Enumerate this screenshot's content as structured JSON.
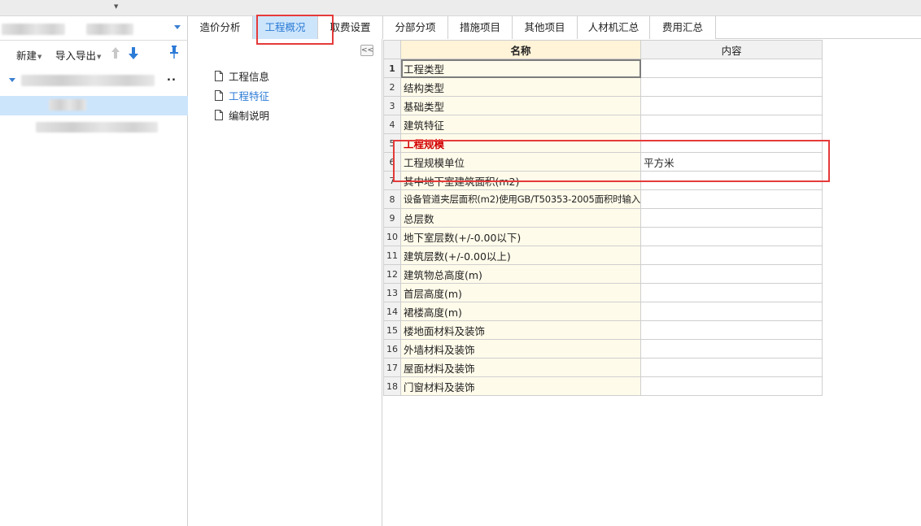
{
  "tabs": [
    {
      "label": "造价分析"
    },
    {
      "label": "工程概况"
    },
    {
      "label": "取费设置"
    },
    {
      "label": "分部分项"
    },
    {
      "label": "措施项目"
    },
    {
      "label": "其他项目"
    },
    {
      "label": "人材机汇总"
    },
    {
      "label": "费用汇总"
    }
  ],
  "active_tab": "工程概况",
  "left_toolbar": {
    "new_label": "新建",
    "import_export_label": "导入导出"
  },
  "doc_nav": [
    {
      "label": "工程信息"
    },
    {
      "label": "工程特征"
    },
    {
      "label": "编制说明"
    }
  ],
  "collapse_symbol": "<<",
  "tree_ellipsis": "..",
  "grid": {
    "headers": {
      "name": "名称",
      "content": "内容"
    },
    "rows": [
      {
        "num": "1",
        "name": "工程类型",
        "content": ""
      },
      {
        "num": "2",
        "name": "结构类型",
        "content": ""
      },
      {
        "num": "3",
        "name": "基础类型",
        "content": ""
      },
      {
        "num": "4",
        "name": "建筑特征",
        "content": ""
      },
      {
        "num": "5",
        "name": "工程规模",
        "content": ""
      },
      {
        "num": "6",
        "name": "工程规模单位",
        "content": "平方米"
      },
      {
        "num": "7",
        "name": "其中地下室建筑面积(m2)",
        "content": ""
      },
      {
        "num": "8",
        "name": "设备管道夹层面积(m2)使用GB/T50353-2005面积时输入",
        "content": ""
      },
      {
        "num": "9",
        "name": "总层数",
        "content": ""
      },
      {
        "num": "10",
        "name": "地下室层数(+/-0.00以下)",
        "content": ""
      },
      {
        "num": "11",
        "name": "建筑层数(+/-0.00以上)",
        "content": ""
      },
      {
        "num": "12",
        "name": "建筑物总高度(m)",
        "content": ""
      },
      {
        "num": "13",
        "name": "首层高度(m)",
        "content": ""
      },
      {
        "num": "14",
        "name": "裙楼高度(m)",
        "content": ""
      },
      {
        "num": "15",
        "name": "楼地面材料及装饰",
        "content": ""
      },
      {
        "num": "16",
        "name": "外墙材料及装饰",
        "content": ""
      },
      {
        "num": "17",
        "name": "屋面材料及装饰",
        "content": ""
      },
      {
        "num": "18",
        "name": "门窗材料及装饰",
        "content": ""
      }
    ]
  },
  "colors": {
    "accent": "#2c7bd6",
    "selection": "#cde5fb",
    "highlight_box": "#e53a3a",
    "name_column_bg": "#fffbea",
    "header_bg": "#fff3d8",
    "section_text": "#d10000"
  },
  "icons": {
    "toolbar_up": "arrow-up-icon",
    "toolbar_down": "arrow-down-icon",
    "toolbar_pin": "pin-icon",
    "doc": "document-icon"
  }
}
